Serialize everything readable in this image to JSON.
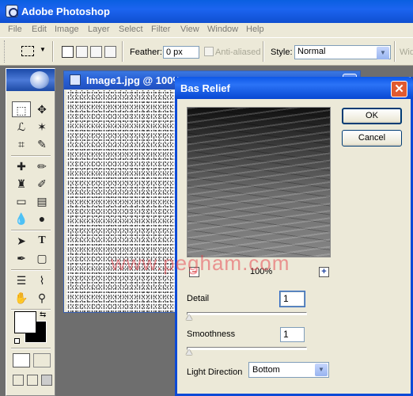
{
  "app": {
    "title": "Adobe Photoshop"
  },
  "menu": [
    "File",
    "Edit",
    "Image",
    "Layer",
    "Select",
    "Filter",
    "View",
    "Window",
    "Help"
  ],
  "options": {
    "feather_label": "Feather:",
    "feather_value": "0 px",
    "antialias_label": "Anti-aliased",
    "style_label": "Style:",
    "style_value": "Normal",
    "extra_label": "Wid"
  },
  "image_window": {
    "title": "Image1.jpg @ 100%"
  },
  "dialog": {
    "title": "Bas Relief",
    "ok_label": "OK",
    "cancel_label": "Cancel",
    "zoom_out": "–",
    "zoom_in": "+",
    "zoom_value": "100%",
    "detail_label": "Detail",
    "detail_value": "1",
    "detail_level": 0,
    "smoothness_label": "Smoothness",
    "smoothness_value": "1",
    "smoothness_level": 0,
    "light_direction_label": "Light Direction",
    "light_direction_value": "Bottom"
  },
  "watermark": "www.pegham.com"
}
